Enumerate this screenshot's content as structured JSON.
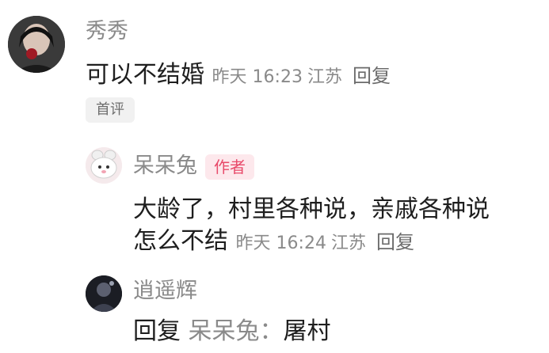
{
  "comment1": {
    "user": "秀秀",
    "text": "可以不结婚",
    "time": "昨天 16:23",
    "location": "江苏",
    "reply_label": "回复",
    "tag": "首评"
  },
  "reply1": {
    "user": "呆呆兔",
    "badge": "作者",
    "text_line1": "大龄了，村里各种说，亲戚各种说",
    "text_line2": "怎么不结",
    "time": "昨天 16:24",
    "location": "江苏",
    "reply_label": "回复"
  },
  "reply2": {
    "user": "逍遥辉",
    "prefix": "回复",
    "target": "呆呆兔：",
    "text": "屠村"
  },
  "colors": {
    "meta_gray": "#8a8a8a",
    "author_badge_bg": "#fde8ec",
    "author_badge_text": "#e84a6a"
  }
}
